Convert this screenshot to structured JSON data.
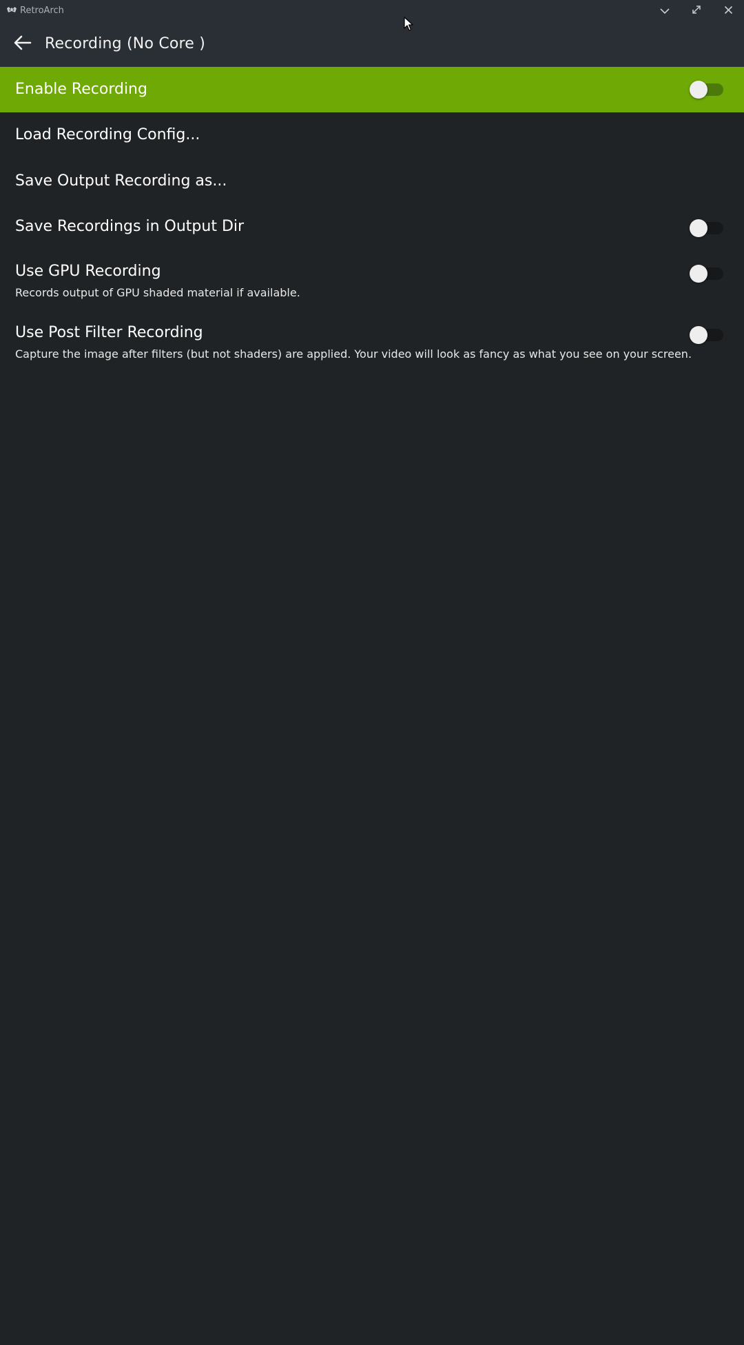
{
  "window": {
    "title": "RetroArch"
  },
  "header": {
    "title": "Recording (No Core )"
  },
  "settings": {
    "items": [
      {
        "label": "Enable Recording",
        "has_toggle": true,
        "toggle_on": false,
        "selected": true
      },
      {
        "label": "Load Recording Config...",
        "has_toggle": false
      },
      {
        "label": "Save Output Recording as...",
        "has_toggle": false
      },
      {
        "label": "Save Recordings in Output Dir",
        "has_toggle": true,
        "toggle_on": false
      },
      {
        "label": "Use GPU Recording",
        "sublabel": "Records output of GPU shaded material if available.",
        "has_toggle": true,
        "toggle_on": false
      },
      {
        "label": "Use Post Filter Recording",
        "sublabel": "Capture the image after filters (but not shaders) are applied. Your video will look as fancy as what you see on your screen.",
        "has_toggle": true,
        "toggle_on": false
      }
    ]
  },
  "colors": {
    "accent": "#6fa905",
    "background": "#202325",
    "header": "#2a2f35"
  },
  "icons": {
    "app": "retroarch-logo-icon",
    "minimize": "chevron-down-icon",
    "maximize": "expand-icon",
    "close": "close-icon",
    "back": "arrow-left-icon"
  }
}
